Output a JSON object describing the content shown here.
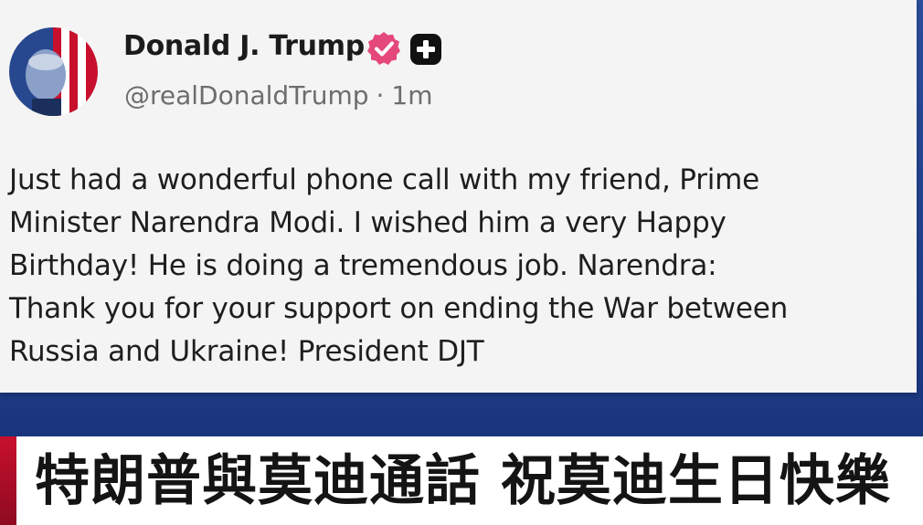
{
  "post": {
    "author_name": "Donald J. Trump",
    "handle": "@realDonaldTrump",
    "separator": "·",
    "time": "1m",
    "icons": {
      "verified": "verified-badge-icon",
      "plus_badge": "plus-badge-icon"
    },
    "colors": {
      "verified": "#e5487b",
      "plus_badge": "#111111"
    },
    "body_lines": [
      "Just had a wonderful phone call with my friend, Prime",
      "Minister Narendra Modi. I wished him a very Happy",
      "Birthday! He is doing a tremendous job. Narendra:",
      "Thank you for your support on ending the War between",
      "Russia and Ukraine! President DJT"
    ]
  },
  "ticker": {
    "headline": "特朗普與莫迪通話 祝莫迪生日快樂"
  }
}
